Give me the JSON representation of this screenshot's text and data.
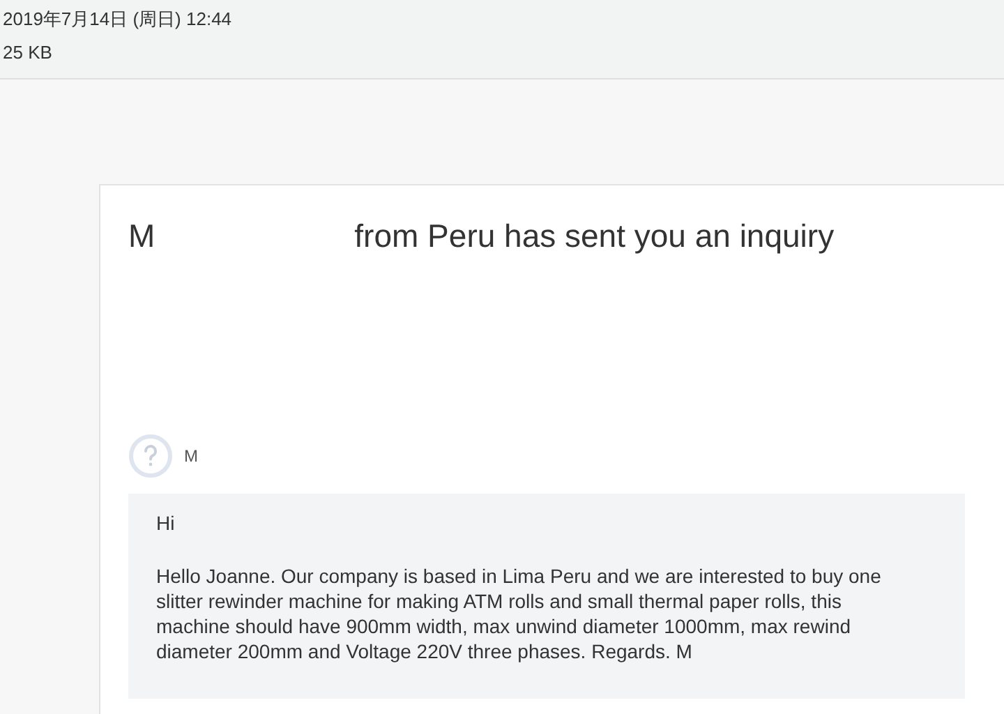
{
  "header": {
    "date": "2019年7月14日 (周日) 12:44",
    "size": "25 KB"
  },
  "email": {
    "title_start": "M",
    "title_end": "from Peru has sent you an inquiry",
    "sender": "M",
    "message": {
      "greeting": "Hi",
      "body": "Hello Joanne. Our company is based in Lima Peru and we are interested to buy one slitter rewinder machine for making ATM rolls and small thermal paper rolls, this machine should have 900mm width, max unwind diameter 1000mm, max rewind diameter 200mm and Voltage 220V three phases. Regards. M"
    }
  }
}
